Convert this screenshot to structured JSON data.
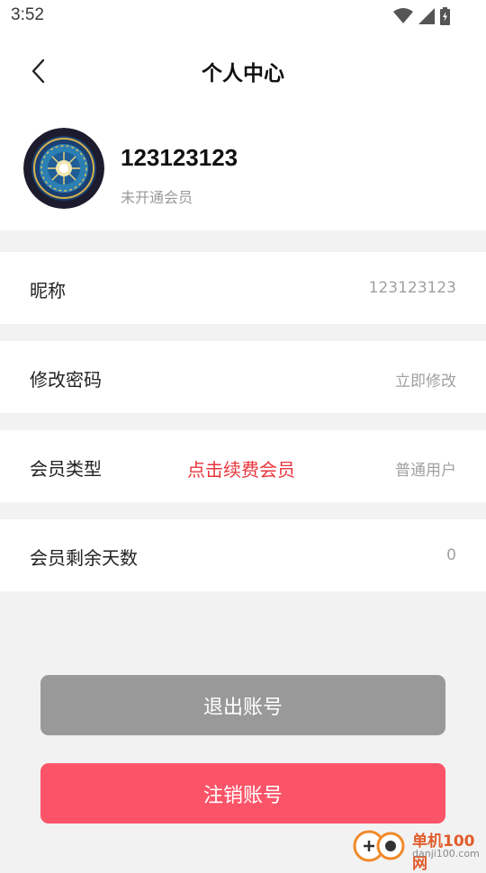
{
  "status_bar": {
    "time": "3:52",
    "icons": [
      "wifi-icon",
      "signal-icon",
      "battery-icon"
    ]
  },
  "header": {
    "title": "个人中心",
    "back_icon": "chevron-left-icon"
  },
  "profile": {
    "username": "123123123",
    "vip_status": "未开通会员"
  },
  "rows": [
    {
      "label": "昵称",
      "value": "123123123"
    },
    {
      "label": "修改密码",
      "value": "立即修改"
    },
    {
      "label": "会员类型",
      "action": "点击续费会员",
      "value": "普通用户"
    },
    {
      "label": "会员剩余天数",
      "value": "0"
    }
  ],
  "buttons": {
    "logout": "退出账号",
    "cancel_account": "注销账号"
  },
  "watermark": {
    "name": "单机100网",
    "url": "danji100.com"
  },
  "colors": {
    "accent_red": "#e8353c",
    "cancel_button": "#fb5468",
    "logout_button": "#999999",
    "background": "#f2f2f2"
  }
}
